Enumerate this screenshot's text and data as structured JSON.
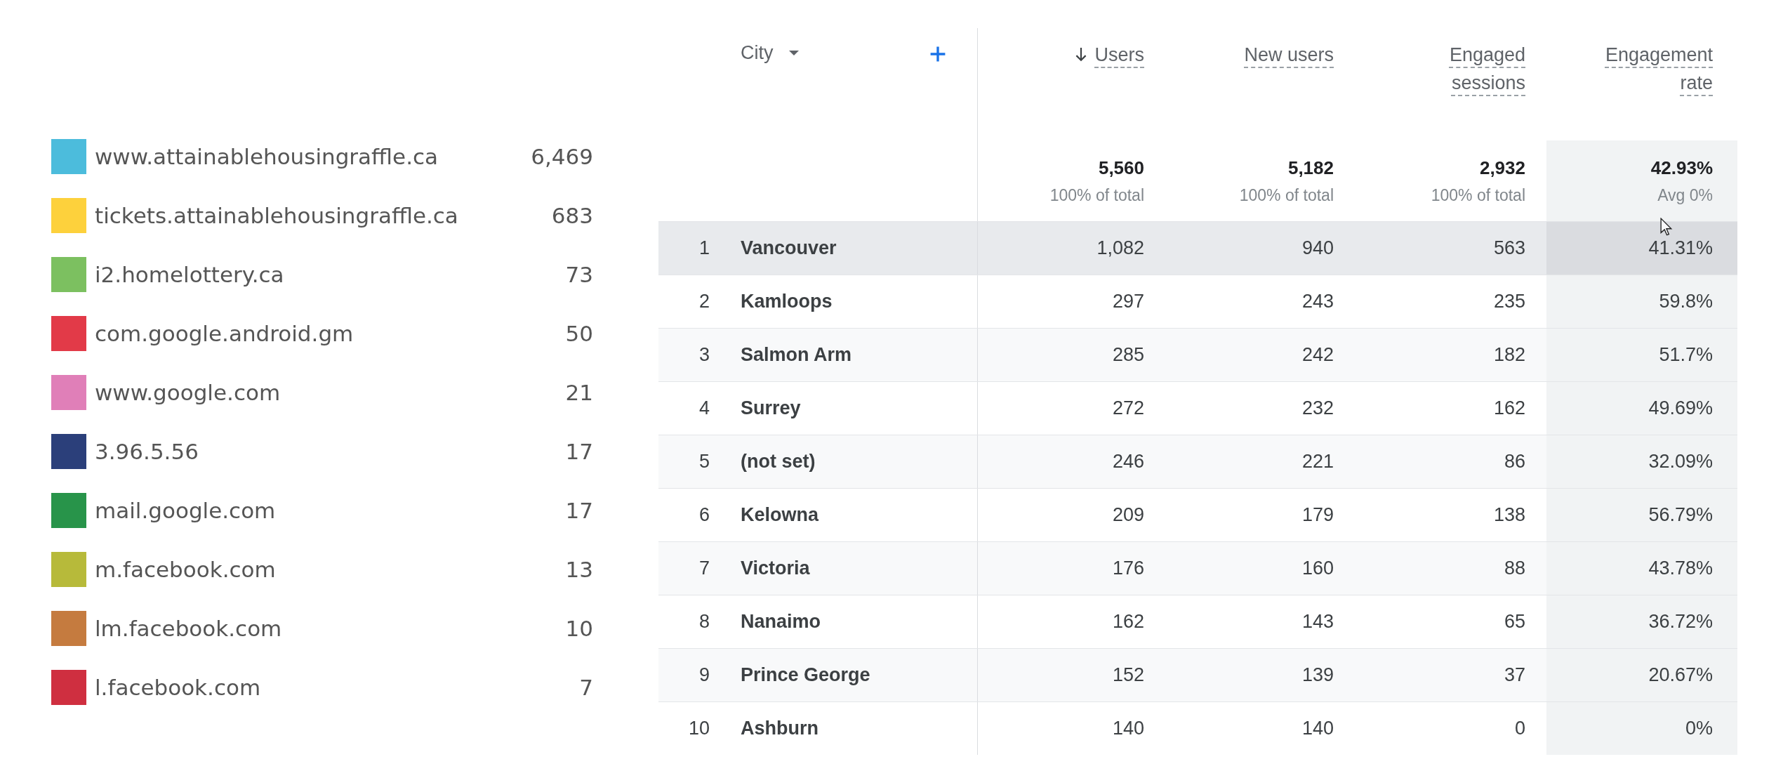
{
  "legend": [
    {
      "label": "www.attainablehousingraffle.ca",
      "value": "6,469",
      "color": "#4cbcdc"
    },
    {
      "label": "tickets.attainablehousingraffle.ca",
      "value": "683",
      "color": "#fdd13c"
    },
    {
      "label": "i2.homelottery.ca",
      "value": "73",
      "color": "#7cc060"
    },
    {
      "label": "com.google.android.gm",
      "value": "50",
      "color": "#e23a48"
    },
    {
      "label": "www.google.com",
      "value": "21",
      "color": "#e07fb8"
    },
    {
      "label": "3.96.5.56",
      "value": "17",
      "color": "#2b3f7a"
    },
    {
      "label": "mail.google.com",
      "value": "17",
      "color": "#28944a"
    },
    {
      "label": "m.facebook.com",
      "value": "13",
      "color": "#b7ba3a"
    },
    {
      "label": "lm.facebook.com",
      "value": "10",
      "color": "#c57b3f"
    },
    {
      "label": "l.facebook.com",
      "value": "7",
      "color": "#cf2f40"
    }
  ],
  "table": {
    "dimension": {
      "label": "City"
    },
    "columns": [
      {
        "label": "Users",
        "sorted": true
      },
      {
        "label": "New users",
        "sorted": false
      },
      {
        "label": "Engaged sessions",
        "sorted": false
      },
      {
        "label": "Engagement rate",
        "sorted": false
      }
    ],
    "totals": [
      {
        "value": "5,560",
        "note": "100% of total"
      },
      {
        "value": "5,182",
        "note": "100% of total"
      },
      {
        "value": "2,932",
        "note": "100% of total"
      },
      {
        "value": "42.93%",
        "note": "Avg 0%"
      }
    ],
    "rows": [
      {
        "index": "1",
        "city": "Vancouver",
        "values": [
          "1,082",
          "940",
          "563",
          "41.31%"
        ],
        "highlighted": true
      },
      {
        "index": "2",
        "city": "Kamloops",
        "values": [
          "297",
          "243",
          "235",
          "59.8%"
        ],
        "highlighted": false
      },
      {
        "index": "3",
        "city": "Salmon Arm",
        "values": [
          "285",
          "242",
          "182",
          "51.7%"
        ],
        "highlighted": false
      },
      {
        "index": "4",
        "city": "Surrey",
        "values": [
          "272",
          "232",
          "162",
          "49.69%"
        ],
        "highlighted": false
      },
      {
        "index": "5",
        "city": "(not set)",
        "values": [
          "246",
          "221",
          "86",
          "32.09%"
        ],
        "highlighted": false
      },
      {
        "index": "6",
        "city": "Kelowna",
        "values": [
          "209",
          "179",
          "138",
          "56.79%"
        ],
        "highlighted": false
      },
      {
        "index": "7",
        "city": "Victoria",
        "values": [
          "176",
          "160",
          "88",
          "43.78%"
        ],
        "highlighted": false
      },
      {
        "index": "8",
        "city": "Nanaimo",
        "values": [
          "162",
          "143",
          "65",
          "36.72%"
        ],
        "highlighted": false
      },
      {
        "index": "9",
        "city": "Prince George",
        "values": [
          "152",
          "139",
          "37",
          "20.67%"
        ],
        "highlighted": false
      },
      {
        "index": "10",
        "city": "Ashburn",
        "values": [
          "140",
          "140",
          "0",
          "0%"
        ],
        "highlighted": false
      }
    ]
  }
}
